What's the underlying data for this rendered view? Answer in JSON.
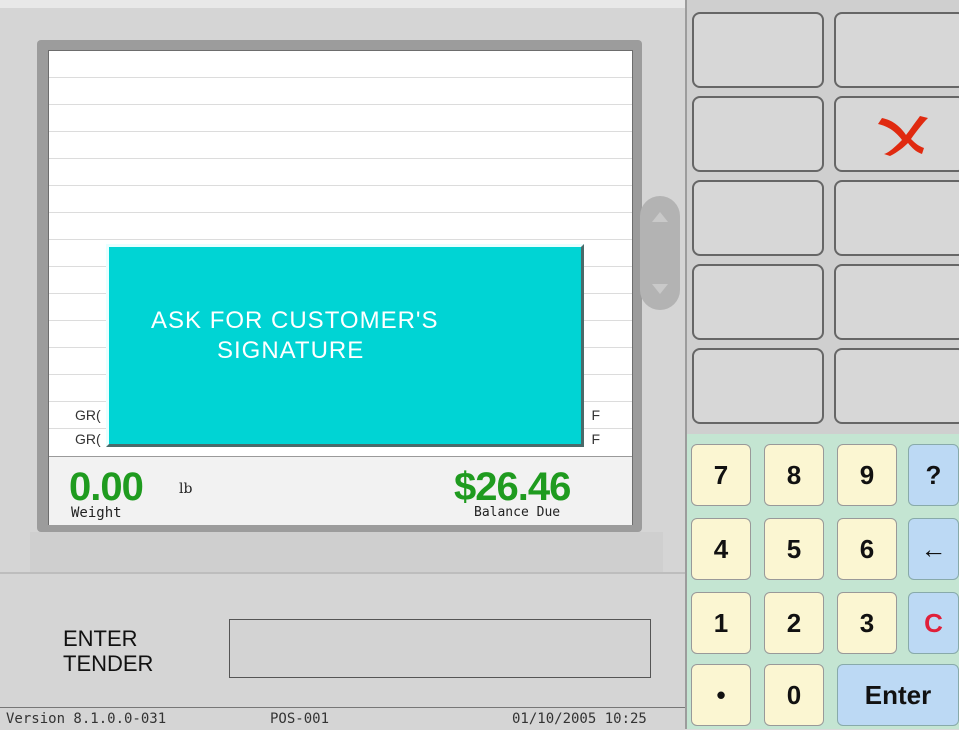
{
  "items": [
    {
      "left": "GR(",
      "right": "F"
    },
    {
      "left": "GR(",
      "right": "F"
    }
  ],
  "totals": {
    "weight_value": "0.00",
    "weight_unit": "lb",
    "weight_label": "Weight",
    "balance_value": "$26.46",
    "balance_label": "Balance Due"
  },
  "dialog": {
    "line1": "ASK  FOR  CUSTOMER'S",
    "line2": "SIGNATURE"
  },
  "prompt": {
    "line1": "ENTER",
    "line2": "TENDER"
  },
  "status": {
    "version": "Version  8.1.0.0-031",
    "pos": "POS-001",
    "datetime": "01/10/2005 10:25"
  },
  "keypad": {
    "k7": "7",
    "k8": "8",
    "k9": "9",
    "help": "?",
    "k4": "4",
    "k5": "5",
    "k6": "6",
    "back": "←",
    "k1": "1",
    "k2": "2",
    "k3": "3",
    "clear": "C",
    "dot": "•",
    "k0": "0",
    "enter": "Enter"
  },
  "icons": {
    "cancel": "close-icon"
  },
  "colors": {
    "dialog_bg": "#00d4d4",
    "amount_green": "#1f9b1f",
    "cancel_red": "#e02a10",
    "clear_red": "#e0203a",
    "keypad_bg": "#c4e5d2"
  }
}
